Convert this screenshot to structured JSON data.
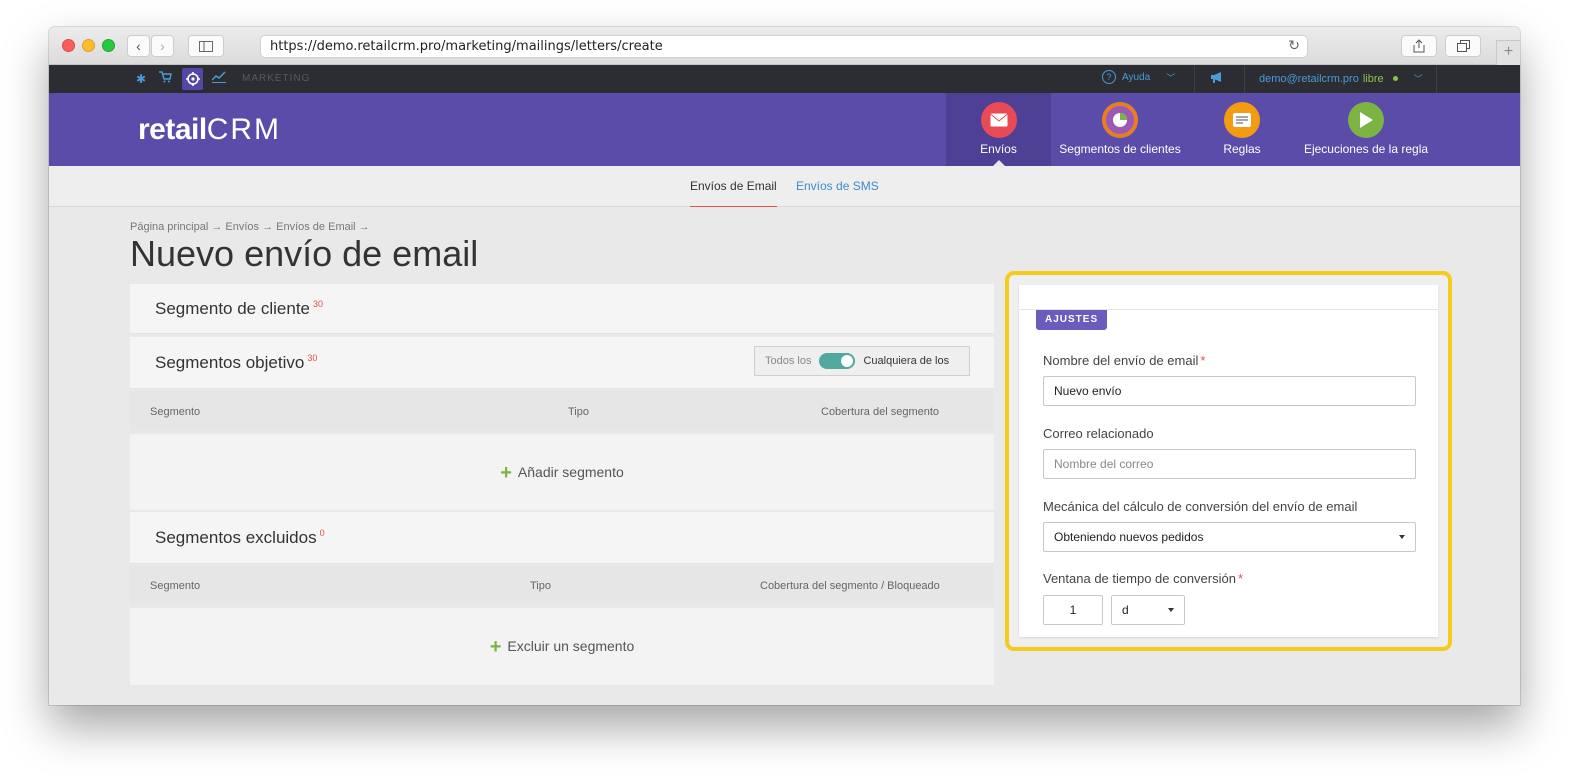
{
  "browser": {
    "url": "https://demo.retailcrm.pro/marketing/mailings/letters/create"
  },
  "topbar": {
    "section_label": "MARKETING",
    "help_label": "Ayuda",
    "user_email": "demo@retailcrm.pro",
    "user_plan": "libre"
  },
  "header": {
    "logo_text": "retail",
    "logo_crm": "CRM",
    "nav": [
      {
        "label": "Envíos",
        "color": "#e84b55"
      },
      {
        "label": "Segmentos de clientes",
        "color": "#9b59b6"
      },
      {
        "label": "Reglas",
        "color": "#f39c12"
      },
      {
        "label": "Ejecuciones de la regla",
        "color": "#7cb342"
      }
    ]
  },
  "subnav": {
    "tabs": [
      {
        "label": "Envíos de Email"
      },
      {
        "label": "Envíos de SMS"
      }
    ]
  },
  "page": {
    "breadcrumb": "Página principal → Envíos → Envíos de Email →",
    "title": "Nuevo envío de email"
  },
  "segments": {
    "client_segment": {
      "title": "Segmento de cliente",
      "count": "30"
    },
    "target": {
      "title": "Segmentos objetivo",
      "count": "30",
      "toggle_off_label": "Todos los",
      "toggle_on_label": "Cualquiera de los",
      "columns": [
        "Segmento",
        "Tipo",
        "Cobertura del segmento"
      ],
      "add_label": "Añadir segmento"
    },
    "excluded": {
      "title": "Segmentos excluidos",
      "count": "0",
      "columns": [
        "Segmento",
        "Tipo",
        "Cobertura del segmento / Bloqueado"
      ],
      "add_label": "Excluir un segmento"
    }
  },
  "settings": {
    "badge": "AJUSTES",
    "name_label": "Nombre del envío de email",
    "name_value": "Nuevo envío",
    "mail_label": "Correo relacionado",
    "mail_placeholder": "Nombre del correo",
    "conversion_label": "Mecánica del cálculo de conversión del envío de email",
    "conversion_value": "Obteniendo nuevos pedidos",
    "window_label": "Ventana de tiempo de conversión",
    "window_value": "1",
    "window_unit": "d"
  },
  "colors": {
    "header_purple": "#5a4ca8",
    "highlight": "#f5cc1d",
    "required": "#d9534f",
    "add_plus": "#7cb342"
  }
}
